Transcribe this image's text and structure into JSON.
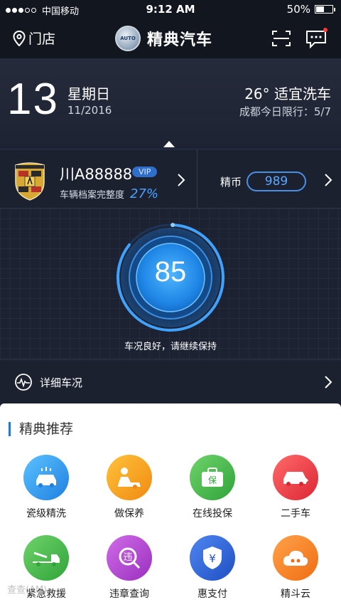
{
  "status_bar": {
    "carrier": "中国移动",
    "time": "9:12 AM",
    "battery_percent": "50%",
    "battery_level": 0.5
  },
  "nav": {
    "store_label": "门店",
    "brand_name": "精典汽车",
    "brand_logo_text": "JINGDIAN AUTO"
  },
  "today": {
    "day": "13",
    "weekday": "星期日",
    "month_year": "11/2016",
    "weather": "26°  适宜洗车",
    "restriction": "成都今日限行：5/7"
  },
  "car": {
    "plate": "川A88888",
    "vip_badge": "VIP",
    "completion_label": "车辆档案完整度",
    "completion_value": "27%",
    "coin_label": "精币",
    "coin_value": "989"
  },
  "health": {
    "score": "85",
    "score_fraction": 0.85,
    "message": "车况良好，请继续保持"
  },
  "detail": {
    "label": "详细车况"
  },
  "recommend": {
    "title": "精典推荐",
    "tiles": [
      {
        "label": "瓷级精洗",
        "icon": "car-wash-icon",
        "color": "#2b9bea"
      },
      {
        "label": "做保养",
        "icon": "maintenance-icon",
        "color": "#f5a623"
      },
      {
        "label": "在线投保",
        "icon": "insurance-icon",
        "color": "#3fb64a"
      },
      {
        "label": "二手车",
        "icon": "used-car-icon",
        "color": "#e8394a"
      },
      {
        "label": "紧急救援",
        "icon": "tow-truck-icon",
        "color": "#3fb64a"
      },
      {
        "label": "违章查询",
        "icon": "violation-search-icon",
        "color": "#b542d4"
      },
      {
        "label": "惠支付",
        "icon": "payment-icon",
        "color": "#2c5fd8"
      },
      {
        "label": "精斗云",
        "icon": "cloud-icon",
        "color": "#f58a1f"
      }
    ]
  },
  "watermark": "查查(AM)"
}
